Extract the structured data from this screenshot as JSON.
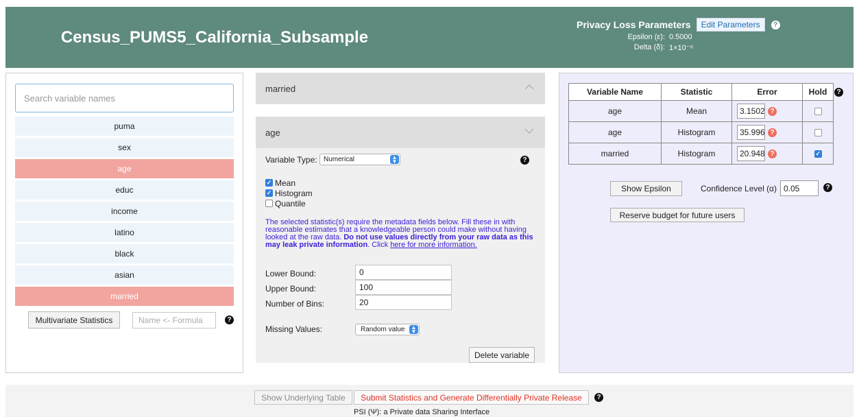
{
  "header": {
    "dataset_title": "Census_PUMS5_California_Subsample",
    "privacy_title": "Privacy Loss Parameters",
    "edit_button": "Edit Parameters",
    "epsilon_label": "Epsilon (ε):",
    "epsilon_value": "0.5000",
    "delta_label": "Delta (δ):",
    "delta_value": "1×10⁻⁶"
  },
  "sidebar": {
    "search_placeholder": "Search variable names",
    "items": [
      {
        "label": "puma",
        "selected": false
      },
      {
        "label": "sex",
        "selected": false
      },
      {
        "label": "age",
        "selected": true
      },
      {
        "label": "educ",
        "selected": false
      },
      {
        "label": "income",
        "selected": false
      },
      {
        "label": "latino",
        "selected": false
      },
      {
        "label": "black",
        "selected": false
      },
      {
        "label": "asian",
        "selected": false
      },
      {
        "label": "married",
        "selected": true
      }
    ],
    "multivariate_button": "Multivariate Statistics",
    "formula_placeholder": "Name <- Formula"
  },
  "middle": {
    "married_header": "married",
    "age_header": "age",
    "variable_type_label": "Variable Type:",
    "variable_type_value": "Numerical",
    "statistics": [
      {
        "label": "Mean",
        "checked": true
      },
      {
        "label": "Histogram",
        "checked": true
      },
      {
        "label": "Quantile",
        "checked": false
      }
    ],
    "notice_part1": "The selected statistic(s) require the metadata fields below. Fill these in with reasonable estimates that a knowledgeable person could make without having looked at the raw data.",
    "notice_bold": "Do not use values directly from your raw data as this may leak private information",
    "notice_part2": ". Click",
    "notice_link": "here for more information.",
    "lower_bound_label": "Lower Bound:",
    "lower_bound_value": "0",
    "upper_bound_label": "Upper Bound:",
    "upper_bound_value": "100",
    "bins_label": "Number of Bins:",
    "bins_value": "20",
    "missing_label": "Missing Values:",
    "missing_value": "Random value",
    "delete_button": "Delete variable"
  },
  "right": {
    "columns": [
      "Variable Name",
      "Statistic",
      "Error",
      "Hold"
    ],
    "rows": [
      {
        "variable": "age",
        "statistic": "Mean",
        "error": "3.1502",
        "hold": false
      },
      {
        "variable": "age",
        "statistic": "Histogram",
        "error": "35.996",
        "hold": false
      },
      {
        "variable": "married",
        "statistic": "Histogram",
        "error": "20.948",
        "hold": true
      }
    ],
    "show_epsilon_button": "Show Epsilon",
    "confidence_label": "Confidence Level (α)",
    "confidence_value": "0.05",
    "reserve_button": "Reserve budget for future users"
  },
  "footer": {
    "show_table_button": "Show Underlying Table",
    "submit_button": "Submit Statistics and Generate Differentially Private Release",
    "tagline": "PSI (Ψ): a Private data Sharing Interface"
  },
  "colors": {
    "header_bg": "#5f8a7e",
    "selected_item": "#f2a59f",
    "list_item": "#edf5fb",
    "right_panel_bg": "#eeedfb",
    "notice_text": "#3a1fd6",
    "submit_text": "#e03121"
  }
}
